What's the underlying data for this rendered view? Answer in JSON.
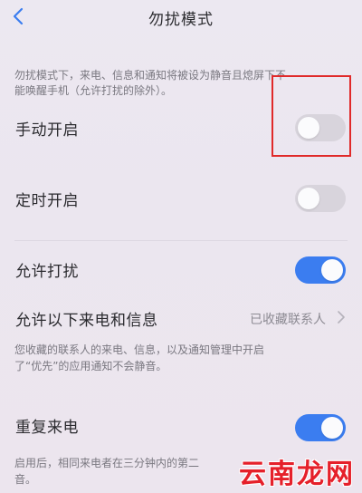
{
  "header": {
    "title": "勿扰模式",
    "back_icon": "chevron-left-icon"
  },
  "intro": {
    "line1": "勿扰模式下，来电、信息和通知将被设为静音且熄屏下不",
    "line2": "能唤醒手机（允许打扰的除外）。"
  },
  "settings": {
    "manual": {
      "label": "手动开启",
      "on": false
    },
    "scheduled": {
      "label": "定时开启",
      "on": false
    },
    "allow_disturb": {
      "label": "允许打扰",
      "on": true
    },
    "allow_calls": {
      "label": "允许以下来电和信息",
      "value": "已收藏联系人",
      "chevron_icon": "chevron-right-icon"
    },
    "allow_calls_desc": {
      "line1": "您收藏的联系人的来电、信息，以及通知管理中开启",
      "line2": "了“优先”的应用通知不会静音。"
    },
    "repeat_calls": {
      "label": "重复来电",
      "on": true
    },
    "repeat_calls_desc": {
      "line1": "启用后，相同来电者在三分钟内的第二",
      "line2": "音。"
    }
  },
  "colors": {
    "accent": "#3b7df0",
    "toggle_off": "#d8d4dc",
    "highlight": "#e02a2a",
    "watermark": "#e5202a"
  },
  "watermark": "云南龙网"
}
